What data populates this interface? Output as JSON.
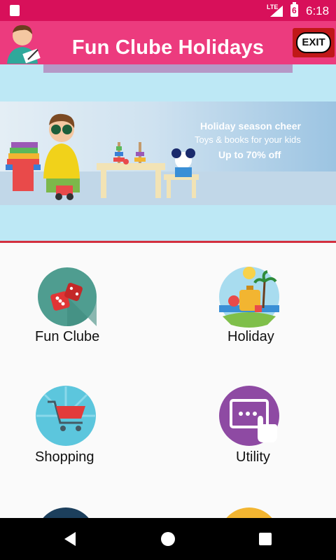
{
  "status_bar": {
    "network": "LTE",
    "battery_level": "6",
    "time": "6:18"
  },
  "app_bar": {
    "title": "Fun Clube Holidays",
    "exit_label": "EXIT"
  },
  "banner": {
    "headline": "Holiday season cheer",
    "subline": "Toys & books for your kids",
    "offer": "Up to 70% off"
  },
  "menu": [
    {
      "label": "Fun Clube"
    },
    {
      "label": "Holiday"
    },
    {
      "label": "Shopping"
    },
    {
      "label": "Utility"
    }
  ],
  "colors": {
    "status_bar": "#d8105a",
    "app_bar": "#ec3b7e",
    "banner_bg": "#bde8f5",
    "divider": "#d32f3f"
  }
}
